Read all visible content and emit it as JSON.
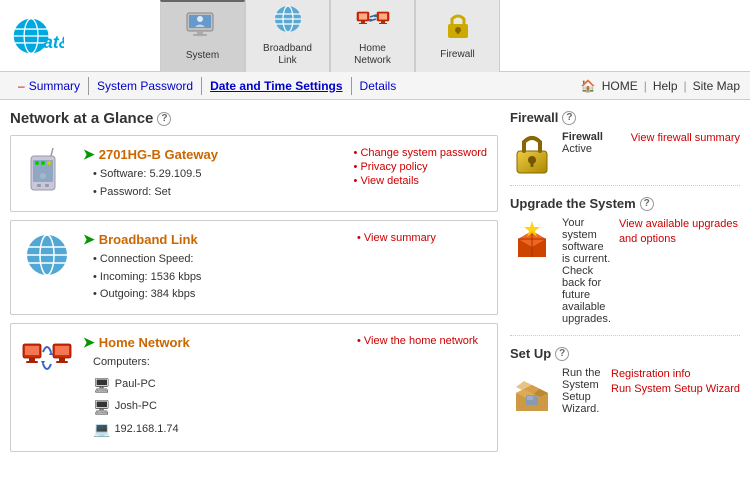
{
  "header": {
    "logo_text": "at&t",
    "tabs": [
      {
        "id": "system",
        "label": "System",
        "active": true
      },
      {
        "id": "broadband-link",
        "label": "Broadband\nLink",
        "active": false
      },
      {
        "id": "home-network",
        "label": "Home\nNetwork",
        "active": false
      },
      {
        "id": "firewall",
        "label": "Firewall",
        "active": false
      }
    ]
  },
  "subnav": {
    "items": [
      {
        "id": "summary",
        "label": "Summary",
        "has_bullet": true,
        "active": true
      },
      {
        "id": "system-password",
        "label": "System Password",
        "has_bullet": false,
        "active": false
      },
      {
        "id": "date-time",
        "label": "Date and Time Settings",
        "has_bullet": false,
        "active": true
      },
      {
        "id": "details",
        "label": "Details",
        "has_bullet": false,
        "active": false
      }
    ],
    "right": {
      "home": "HOME",
      "help": "Help",
      "sitemap": "Site Map"
    }
  },
  "left_panel": {
    "title": "Network at a Glance",
    "gateway_card": {
      "title": "2701HG-B Gateway",
      "details": [
        "Software:  5.29.109.5",
        "Password:  Set"
      ],
      "links": [
        "Change system password",
        "Privacy policy",
        "View details"
      ]
    },
    "broadband_card": {
      "title": "Broadband Link",
      "details": [
        "Connection Speed:",
        "Incoming: 1536  kbps",
        "Outgoing: 384  kbps"
      ],
      "links": [
        "View summary"
      ]
    },
    "home_network_card": {
      "title": "Home Network",
      "computers_label": "Computers:",
      "computers": [
        {
          "name": "Paul-PC",
          "type": "desktop"
        },
        {
          "name": "Josh-PC",
          "type": "desktop"
        },
        {
          "name": "192.168.1.74",
          "type": "laptop"
        }
      ],
      "links": [
        "View the home network"
      ]
    }
  },
  "right_panel": {
    "firewall": {
      "title": "Firewall",
      "status_label": "Firewall",
      "status_value": "Active",
      "links": [
        "View firewall summary"
      ]
    },
    "upgrade": {
      "title": "Upgrade the System",
      "description": "Your system software is current. Check back for future available upgrades.",
      "links": [
        "View available upgrades and options"
      ]
    },
    "setup": {
      "title": "Set Up",
      "description": "Run the System Setup Wizard.",
      "links": [
        "Registration info",
        "Run System Setup Wizard"
      ]
    }
  }
}
